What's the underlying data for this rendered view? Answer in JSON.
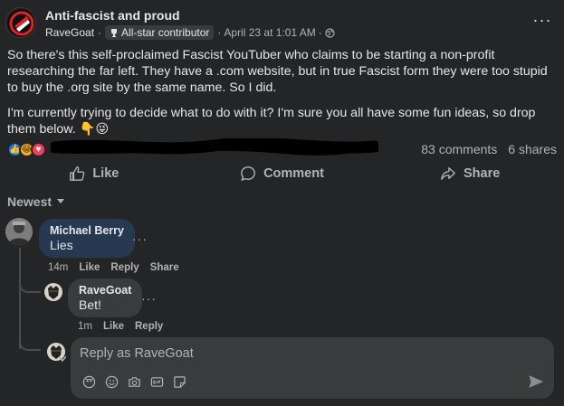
{
  "post": {
    "group_name": "Anti-fascist and proud",
    "author": "RaveGoat",
    "badge": "All-star contributor",
    "timestamp": "April 23 at 1:01 AM",
    "dot": "·",
    "more": "···",
    "paragraph1": "So there's this self-proclaimed Fascist YouTuber who claims to be starting a non-profit researching the far left. They have a .com website, but in true Fascist form they were too stupid to buy the .org site by the same name. So I did.",
    "paragraph2": "I'm currently trying to decide what to do with it? I'm sure you all have some fun ideas, so drop them below. 👇😜",
    "comments_count": "83 comments",
    "shares_count": "6 shares",
    "reactions": [
      "like",
      "haha",
      "love"
    ]
  },
  "actions": {
    "like": "Like",
    "comment": "Comment",
    "share": "Share"
  },
  "sort": {
    "label": "Newest"
  },
  "comments": [
    {
      "name": "Michael Berry",
      "text": "Lies",
      "time": "14m",
      "like": "Like",
      "reply": "Reply",
      "share": "Share",
      "more": "···"
    }
  ],
  "replies": [
    {
      "name": "RaveGoat",
      "text": "Bet!",
      "time": "1m",
      "like": "Like",
      "reply": "Reply",
      "more": "···"
    }
  ],
  "reply_box": {
    "placeholder": "Reply as RaveGoat"
  },
  "colors": {
    "background": "#242526",
    "bubble": "#3a3b3c",
    "highlight_bubble": "#263951",
    "accent_red": "#e41e26",
    "like_blue": "#1877f2"
  }
}
